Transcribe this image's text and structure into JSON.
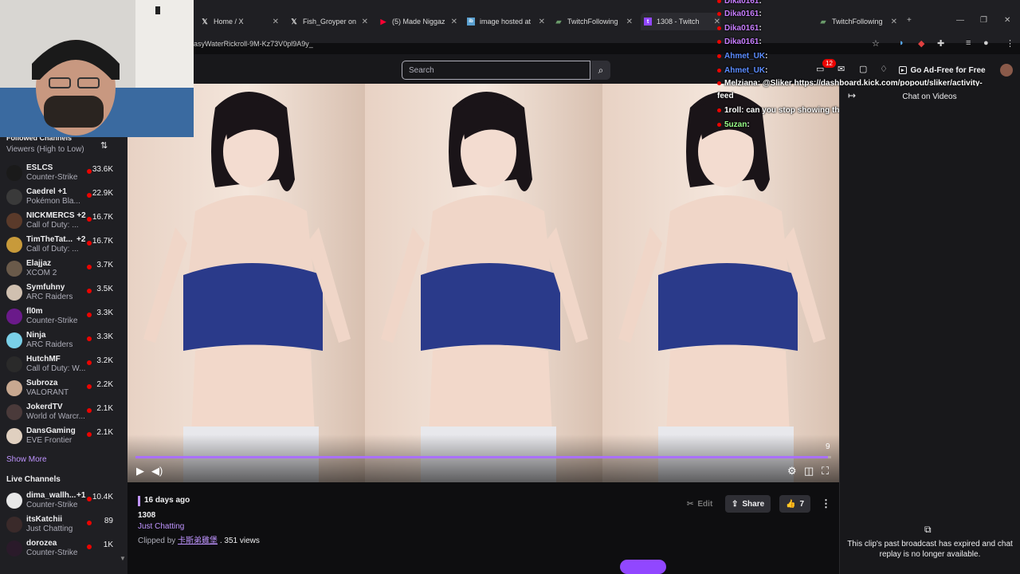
{
  "browser": {
    "tabs": [
      {
        "label": "Home / X",
        "icon": "x-logo-icon"
      },
      {
        "label": "Fish_Groyper on",
        "icon": "x-logo-icon"
      },
      {
        "label": "(5) Made Niggaz",
        "icon": "youtube-icon"
      },
      {
        "label": "image hosted at",
        "icon": "image-host-icon"
      },
      {
        "label": "TwitchFollowing",
        "icon": "twitch-following-icon"
      },
      {
        "label": "1308 - Twitch",
        "icon": "twitch-icon",
        "active": true
      },
      {
        "label": "...",
        "icon": "blank-icon"
      },
      {
        "label": "TwitchFollowing",
        "icon": "twitch-following-icon"
      }
    ],
    "url": "asyWaterRickroll-9M-Kz73V0pl9A9y_"
  },
  "nav": {
    "search_placeholder": "Search",
    "notification_count": "12",
    "ad_free_label": "Go Ad-Free for Free"
  },
  "sidebar": {
    "followed_header": "Followed Channels",
    "sort_label": "Viewers (High to Low)",
    "channels": [
      {
        "name": "ESLCS",
        "game": "Counter-Strike",
        "viewers": "33.6K",
        "plus": "",
        "color": "#1a1a1a"
      },
      {
        "name": "Caedrel +1",
        "game": "Pokémon Bla...",
        "viewers": "22.9K",
        "plus": "",
        "color": "#3a3a3a"
      },
      {
        "name": "NICKMERCS +2",
        "game": "Call of Duty: ...",
        "viewers": "16.7K",
        "plus": "",
        "color": "#5a3a2a"
      },
      {
        "name": "TimTheTat...",
        "game": "Call of Duty: ...",
        "viewers": "16.7K",
        "plus": "+2",
        "color": "#c89a3a"
      },
      {
        "name": "Elajjaz",
        "game": "XCOM 2",
        "viewers": "3.7K",
        "plus": "",
        "color": "#6a5a4a"
      },
      {
        "name": "Symfuhny",
        "game": "ARC Raiders",
        "viewers": "3.5K",
        "plus": "",
        "color": "#d0c0b0"
      },
      {
        "name": "fl0m",
        "game": "Counter-Strike",
        "viewers": "3.3K",
        "plus": "",
        "color": "#6a1a8a"
      },
      {
        "name": "Ninja",
        "game": "ARC Raiders",
        "viewers": "3.3K",
        "plus": "",
        "color": "#7ad0e8"
      },
      {
        "name": "HutchMF",
        "game": "Call of Duty: W...",
        "viewers": "3.2K",
        "plus": "",
        "color": "#2a2a2a"
      },
      {
        "name": "Subroza",
        "game": "VALORANT",
        "viewers": "2.2K",
        "plus": "",
        "color": "#c8a890"
      },
      {
        "name": "JokerdTV",
        "game": "World of Warcr...",
        "viewers": "2.1K",
        "plus": "",
        "color": "#4a3a3a"
      },
      {
        "name": "DansGaming",
        "game": "EVE Frontier",
        "viewers": "2.1K",
        "plus": "",
        "color": "#e0d0c0"
      }
    ],
    "show_more": "Show More",
    "live_header": "Live Channels",
    "live_channels": [
      {
        "name": "dima_wallh...",
        "game": "Counter-Strike",
        "viewers": "10.4K",
        "plus": "+1",
        "color": "#e8e8e8"
      },
      {
        "name": "itsKatchii",
        "game": "Just Chatting",
        "viewers": "89",
        "plus": "",
        "color": "#3a2a2a"
      },
      {
        "name": "dorozea",
        "game": "Counter-Strike",
        "viewers": "1K",
        "plus": "",
        "color": "#2a1a2a"
      }
    ]
  },
  "video": {
    "time_remaining": "9",
    "progress": 0.995
  },
  "chat_overlay": [
    {
      "user": "Dika0161",
      "sep": ":",
      "msg": "",
      "color": "purple"
    },
    {
      "user": "Dika0161",
      "sep": ":",
      "msg": "",
      "color": "purple"
    },
    {
      "user": "Dika0161",
      "sep": ":",
      "msg": "",
      "color": "purple"
    },
    {
      "user": "Dika0161",
      "sep": ":",
      "msg": "",
      "color": "purple"
    },
    {
      "user": "Ahmet_UK",
      "sep": ":",
      "msg": "",
      "color": "blue"
    },
    {
      "user": "Ahmet_UK",
      "sep": ":",
      "msg": "",
      "color": "blue"
    },
    {
      "user": "Melziana",
      "sep": ":",
      "msg": "@Sliker https://dashboard.kick.com/popout/sliker/activity-",
      "color": "yellow"
    },
    {
      "user": "",
      "sep": "",
      "msg": "feed",
      "color": "white"
    },
    {
      "user": "1roll",
      "sep": ":",
      "msg": "can you stop showing this",
      "color": "yellow"
    },
    {
      "user": "5uzan",
      "sep": ":",
      "msg": "",
      "color": "green"
    }
  ],
  "chat_panel": {
    "title": "Chat on Videos",
    "expired_message": "This clip's past broadcast has expired and chat replay is no longer available."
  },
  "clip": {
    "date": "16 days ago",
    "title": "1308",
    "category": "Just Chatting",
    "clipped_by_prefix": "Clipped by",
    "clipper": "卡斯弟雞堡",
    "views": ". 351 views",
    "edit_label": "Edit",
    "share_label": "Share",
    "likes": "7"
  }
}
